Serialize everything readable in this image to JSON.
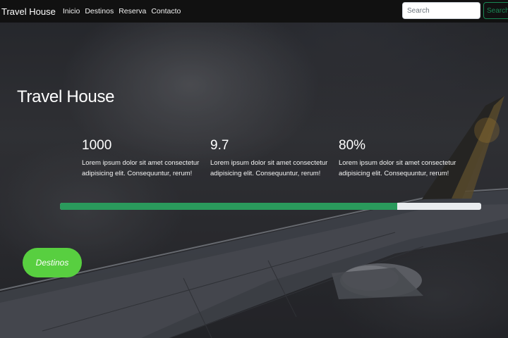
{
  "navbar": {
    "brand": "Travel House",
    "links": [
      "Inicio",
      "Destinos",
      "Reserva",
      "Contacto"
    ],
    "search_placeholder": "Search",
    "search_button": "Search"
  },
  "hero": {
    "title": "Travel House",
    "stats": [
      {
        "value": "1000",
        "description": "Lorem ipsum dolor sit amet consectetur adipisicing elit. Consequuntur, rerum!"
      },
      {
        "value": "9.7",
        "description": "Lorem ipsum dolor sit amet consectetur adipisicing elit. Consequuntur, rerum!"
      },
      {
        "value": "80%",
        "description": "Lorem ipsum dolor sit amet consectetur adipisicing elit. Consequuntur, rerum!"
      }
    ],
    "progress_fraction": 0.8,
    "cta_label": "Destinos"
  },
  "colors": {
    "navbar_bg": "#111111",
    "progress_fill": "#2a9a5c",
    "cta_bg": "#58cf40",
    "search_outline": "#198754"
  },
  "icons": [
    "airplane-wing-background"
  ]
}
